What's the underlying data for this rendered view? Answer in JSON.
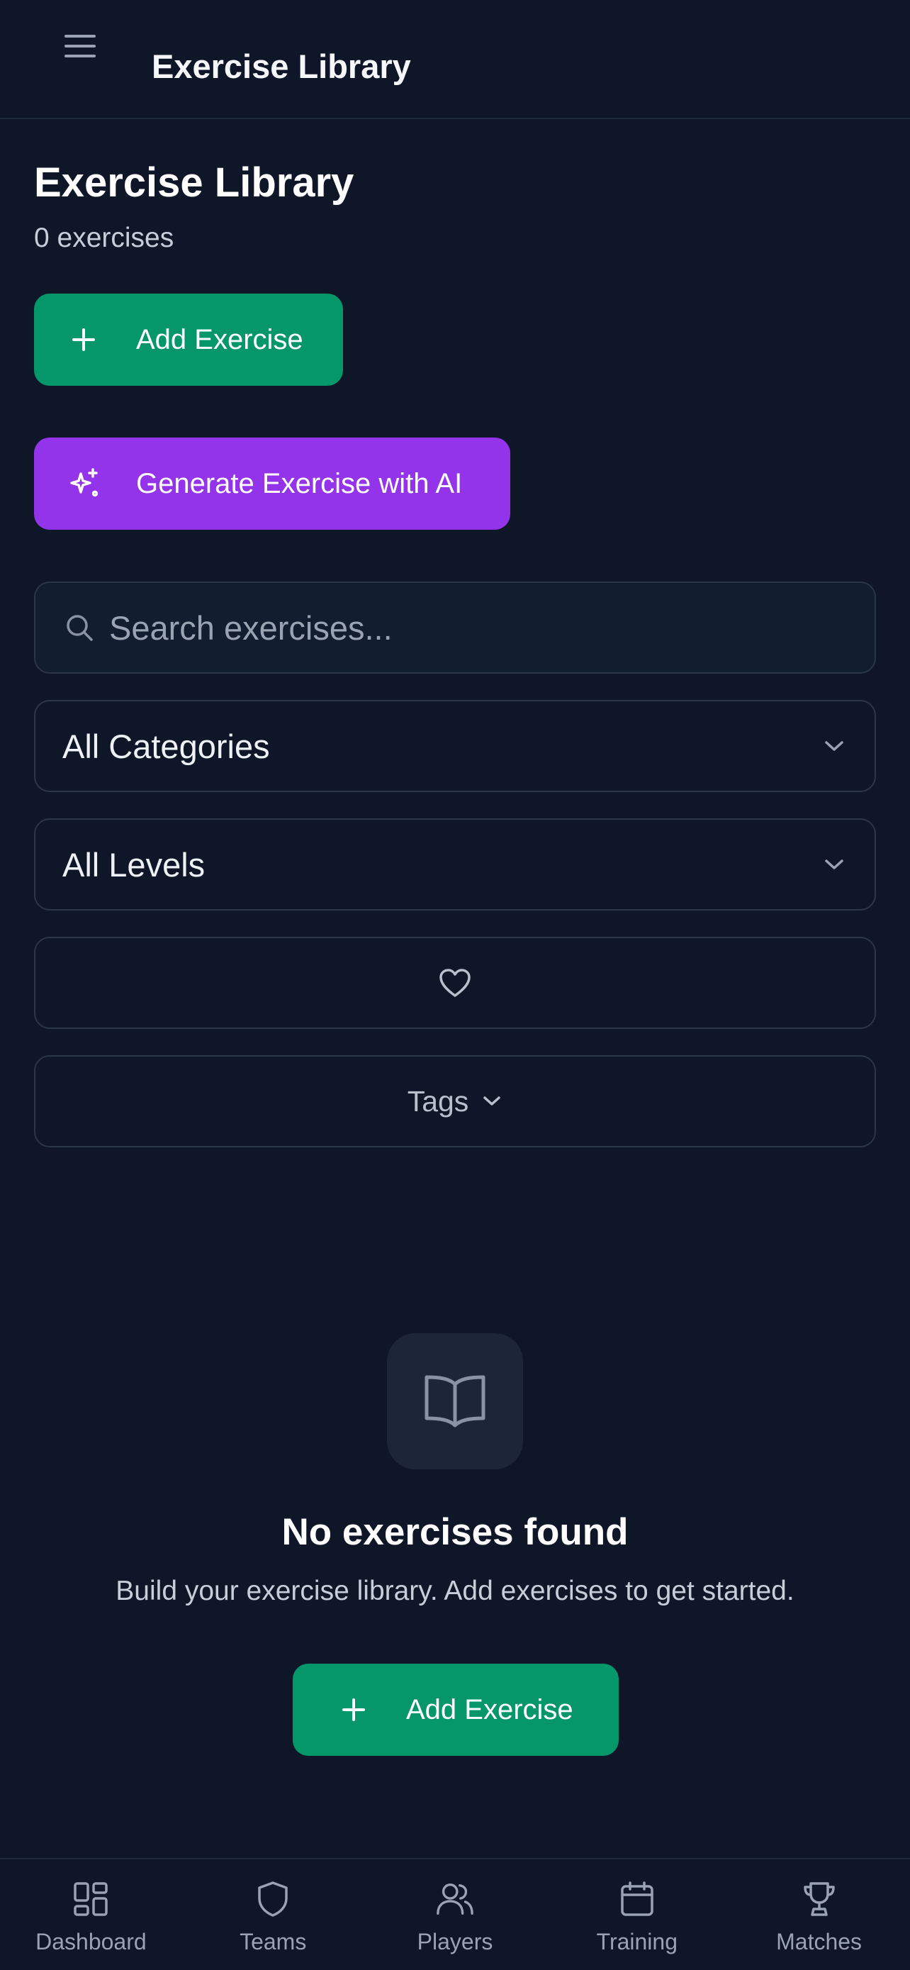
{
  "header": {
    "title": "Exercise Library",
    "menu_icon": "hamburger-menu-icon"
  },
  "page": {
    "title": "Exercise Library",
    "count_text": "0 exercises"
  },
  "actions": {
    "add_exercise_label": "Add Exercise",
    "generate_ai_label": "Generate Exercise with AI"
  },
  "filters": {
    "search_placeholder": "Search exercises...",
    "search_value": "",
    "category_selected": "All Categories",
    "level_selected": "All Levels",
    "tags_label": "Tags"
  },
  "empty_state": {
    "title": "No exercises found",
    "description": "Build your exercise library. Add exercises to get started.",
    "button_label": "Add Exercise"
  },
  "bottom_nav": {
    "items": [
      {
        "label": "Dashboard",
        "icon": "dashboard-icon"
      },
      {
        "label": "Teams",
        "icon": "shield-icon"
      },
      {
        "label": "Players",
        "icon": "users-icon"
      },
      {
        "label": "Training",
        "icon": "calendar-icon"
      },
      {
        "label": "Matches",
        "icon": "trophy-icon"
      }
    ]
  },
  "colors": {
    "background": "#0e1628",
    "primary_green": "#059669",
    "ai_purple": "#9333ea",
    "border": "#2b3649"
  }
}
